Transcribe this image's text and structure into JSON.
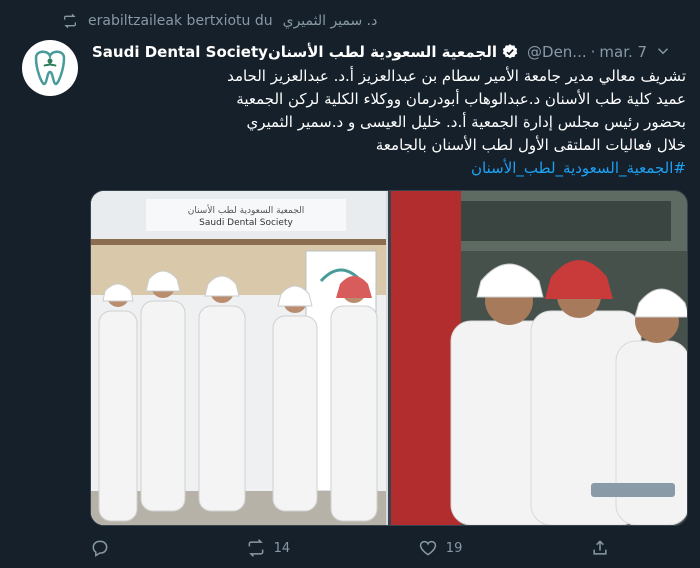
{
  "retweet": {
    "text": "erabiltzaileak bertxiotu du",
    "user": "د. سمير الثميري"
  },
  "author": {
    "display_name": "الجمعية السعودية لطب الأسنانSaudi Dental Society",
    "handle": "@Den...",
    "separator": "·",
    "date": "mar. 7"
  },
  "tweet": {
    "lines": [
      "تشريف معالي مدير جامعة الأمير سطام بن عبدالعزيز أ.د. عبدالعزيز الحامد",
      "عميد كلية طب الأسنان د.عبدالوهاب أبودرمان ووكلاء الكلية لركن الجمعية",
      "بحضور رئيس مجلس إدارة الجمعية أ.د. خليل العيسى و د.سمير الثميري",
      "خلال فعاليات الملتقى الأول لطب الأسنان بالجامعة"
    ],
    "hashtag": "#الجمعية_السعودية_لطب_الأسنان"
  },
  "media": {
    "booth_sign_ar": "الجمعية السعودية لطب الأسنان",
    "booth_sign_en": "Saudi Dental Society"
  },
  "actions": {
    "replies": "",
    "retweets": "14",
    "likes": "19"
  },
  "colors": {
    "background": "#15202b",
    "link": "#1da1f2",
    "muted": "#8899a6",
    "logo": "#4a9a9a"
  }
}
